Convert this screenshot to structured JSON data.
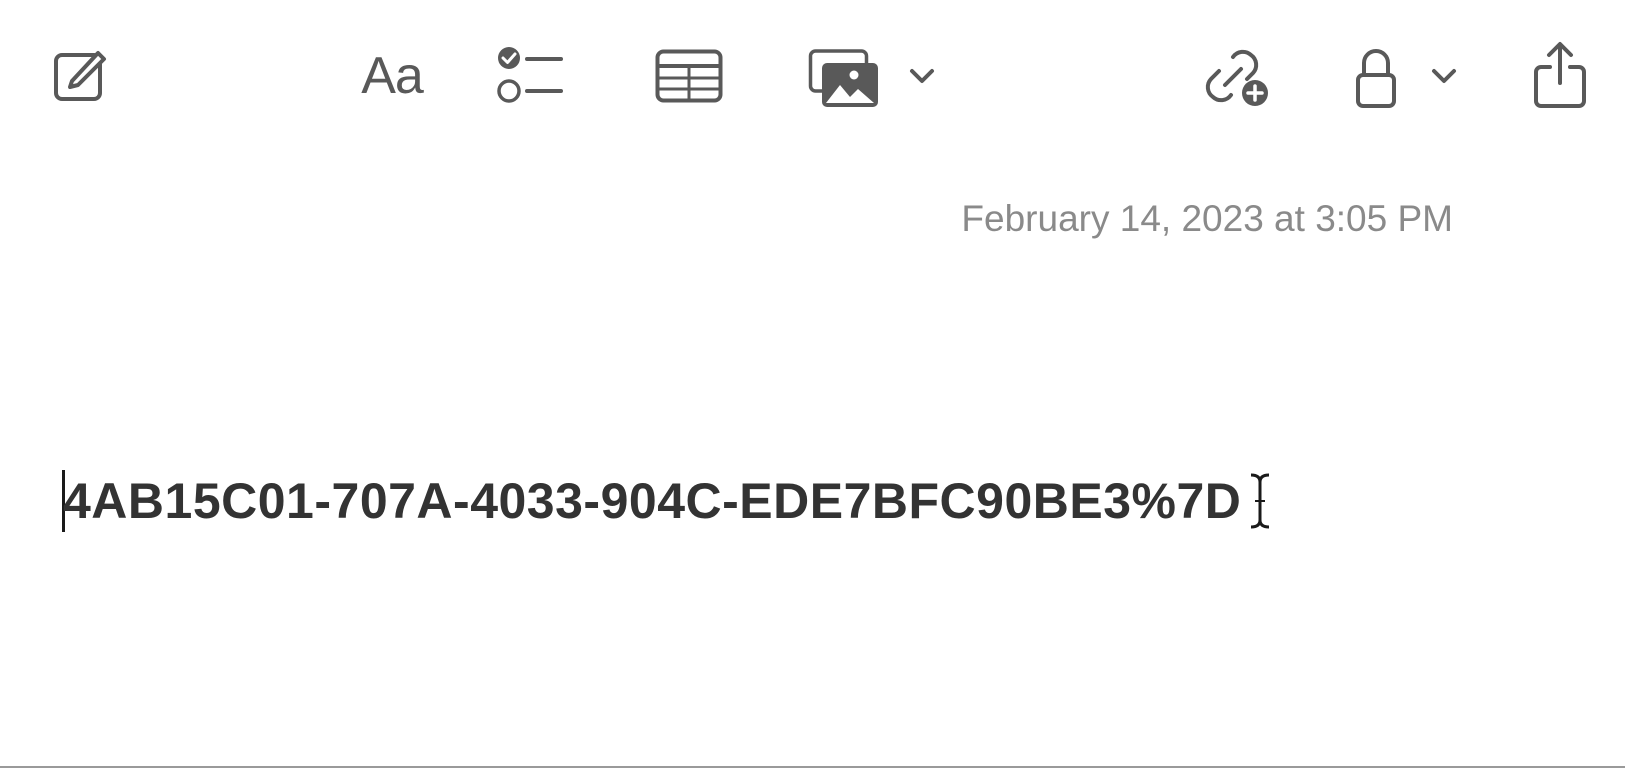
{
  "toolbar": {
    "compose": {
      "icon": "compose-icon"
    },
    "format": {
      "label": "Aa",
      "icon": "text-format-icon"
    },
    "checklist": {
      "icon": "checklist-icon"
    },
    "table": {
      "icon": "table-icon"
    },
    "media": {
      "icon": "photo-icon",
      "menu_icon": "chevron-down-icon"
    },
    "collaborate": {
      "icon": "link-add-icon"
    },
    "lock": {
      "icon": "lock-icon",
      "menu_icon": "chevron-down-icon"
    },
    "share": {
      "icon": "share-icon"
    }
  },
  "note": {
    "timestamp": "February 14, 2023 at 3:05 PM",
    "body": "4AB15C01-707A-4033-904C-EDE7BFC90BE3%7D"
  },
  "colors": {
    "icon": "#595959",
    "text": "#333333",
    "timestamp": "#8a8a8a",
    "background": "#ffffff"
  }
}
